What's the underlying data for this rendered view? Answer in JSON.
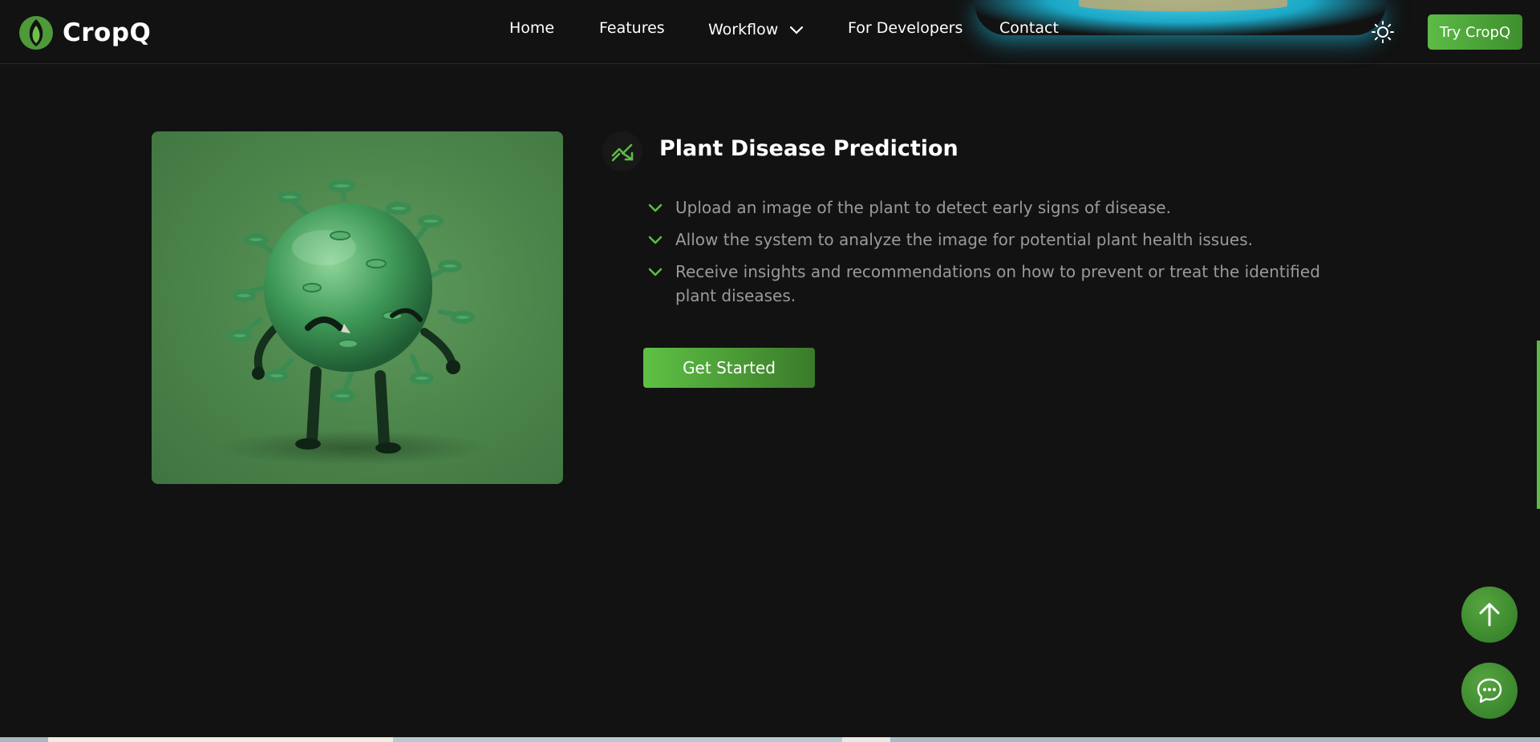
{
  "brand": {
    "name": "CropQ"
  },
  "nav": {
    "items": [
      {
        "label": "Home"
      },
      {
        "label": "Features"
      },
      {
        "label": "Workflow"
      },
      {
        "label": "For Developers"
      },
      {
        "label": "Contact"
      }
    ],
    "cta_label": "Try CropQ"
  },
  "feature": {
    "image_alt": "virus-character-illustration",
    "icon": "trending-up-icon",
    "title": "Plant Disease Prediction",
    "bullets": [
      "Upload an image of the plant to detect early signs of disease.",
      "Allow the system to analyze the image for potential plant health issues.",
      "Receive insights and recommendations on how to prevent or treat the identified plant diseases."
    ],
    "button_label": "Get Started"
  },
  "colors": {
    "background": "#121212",
    "accent": "#5dbb46",
    "text_muted": "#9a9a9a"
  }
}
